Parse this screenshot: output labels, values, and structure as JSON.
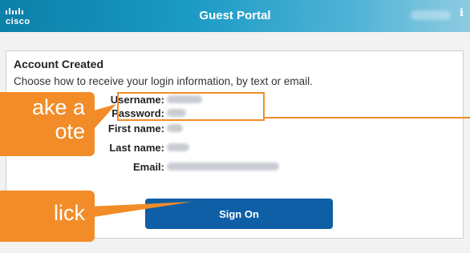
{
  "header": {
    "logo_text": "cisco",
    "title": "Guest Portal",
    "info_icon": "i"
  },
  "card": {
    "title": "Account Created",
    "subtitle": "Choose how to receive your login information, by text or email.",
    "fields": [
      {
        "label": "Username:"
      },
      {
        "label": "Password:"
      },
      {
        "label": "First name:"
      },
      {
        "label": "Last name:"
      },
      {
        "label": "Email:"
      }
    ],
    "signon_label": "Sign On"
  },
  "callouts": {
    "note": "ake a\note",
    "click": "lick"
  },
  "colors": {
    "header_start": "#0b7fa8",
    "accent_orange": "#f28c28",
    "button_blue": "#0e5fa6"
  },
  "icons": {
    "logo": "cisco-logo-icon",
    "info": "info-icon"
  }
}
